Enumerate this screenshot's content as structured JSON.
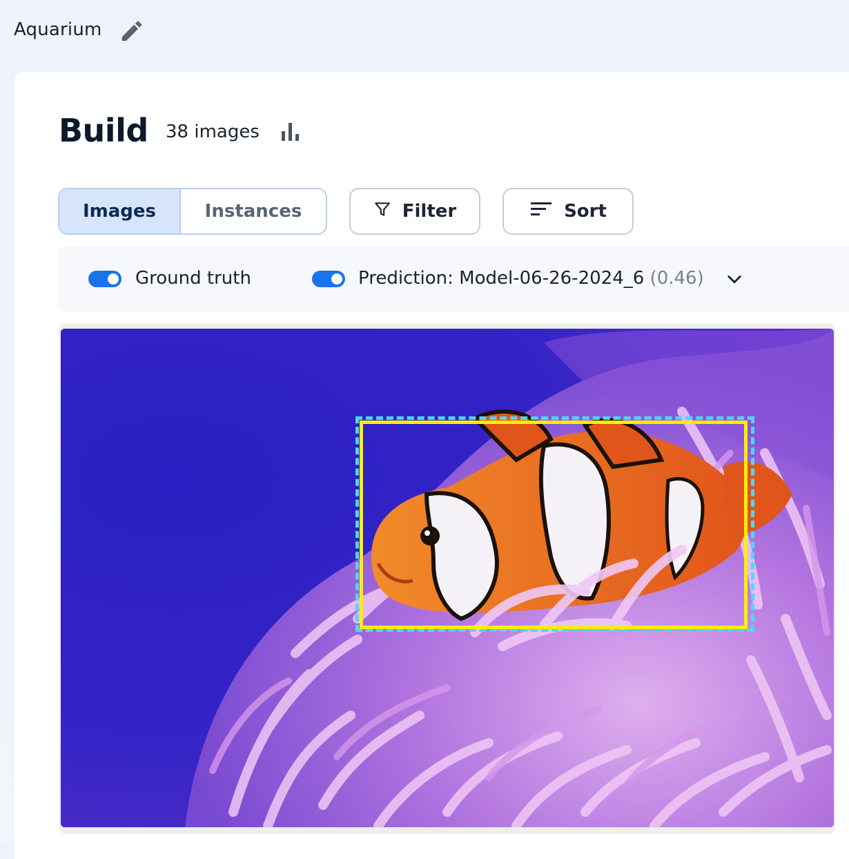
{
  "header": {
    "project_name": "Aquarium"
  },
  "build": {
    "title": "Build",
    "image_count": "38 images"
  },
  "view_tabs": [
    {
      "label": "Images",
      "active": true
    },
    {
      "label": "Instances",
      "active": false
    }
  ],
  "toolbar": {
    "filter_label": "Filter",
    "sort_label": "Sort"
  },
  "toggles": {
    "ground_truth": {
      "label": "Ground truth",
      "enabled": true
    },
    "prediction": {
      "label": "Prediction: Model-06-26-2024_6",
      "score": "(0.46)",
      "enabled": true
    }
  },
  "colors": {
    "accent": "#1a73e8",
    "ground_truth_box": "#ffef00",
    "prediction_box": "#4fd6ff"
  }
}
